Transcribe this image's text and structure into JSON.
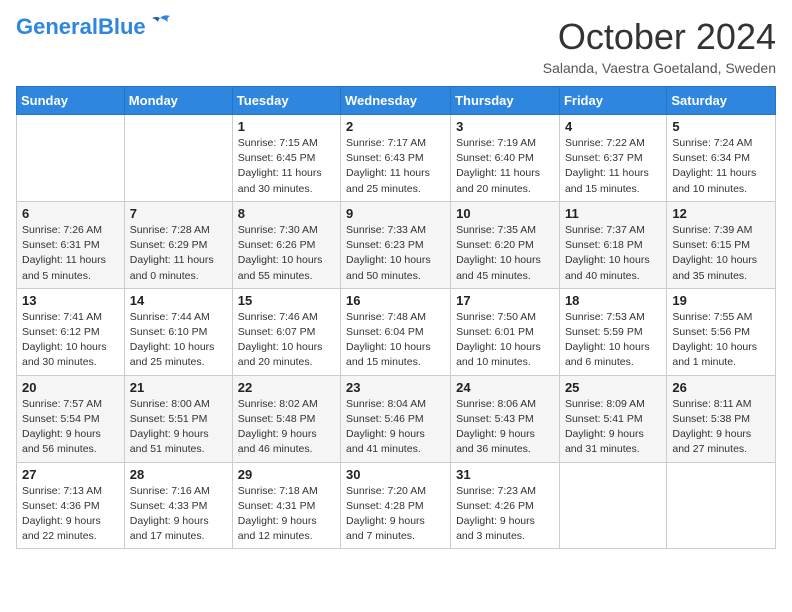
{
  "header": {
    "logo_general": "General",
    "logo_blue": "Blue",
    "month": "October 2024",
    "location": "Salanda, Vaestra Goetaland, Sweden"
  },
  "weekdays": [
    "Sunday",
    "Monday",
    "Tuesday",
    "Wednesday",
    "Thursday",
    "Friday",
    "Saturday"
  ],
  "weeks": [
    [
      {
        "day": "",
        "info": ""
      },
      {
        "day": "",
        "info": ""
      },
      {
        "day": "1",
        "info": "Sunrise: 7:15 AM\nSunset: 6:45 PM\nDaylight: 11 hours and 30 minutes."
      },
      {
        "day": "2",
        "info": "Sunrise: 7:17 AM\nSunset: 6:43 PM\nDaylight: 11 hours and 25 minutes."
      },
      {
        "day": "3",
        "info": "Sunrise: 7:19 AM\nSunset: 6:40 PM\nDaylight: 11 hours and 20 minutes."
      },
      {
        "day": "4",
        "info": "Sunrise: 7:22 AM\nSunset: 6:37 PM\nDaylight: 11 hours and 15 minutes."
      },
      {
        "day": "5",
        "info": "Sunrise: 7:24 AM\nSunset: 6:34 PM\nDaylight: 11 hours and 10 minutes."
      }
    ],
    [
      {
        "day": "6",
        "info": "Sunrise: 7:26 AM\nSunset: 6:31 PM\nDaylight: 11 hours and 5 minutes."
      },
      {
        "day": "7",
        "info": "Sunrise: 7:28 AM\nSunset: 6:29 PM\nDaylight: 11 hours and 0 minutes."
      },
      {
        "day": "8",
        "info": "Sunrise: 7:30 AM\nSunset: 6:26 PM\nDaylight: 10 hours and 55 minutes."
      },
      {
        "day": "9",
        "info": "Sunrise: 7:33 AM\nSunset: 6:23 PM\nDaylight: 10 hours and 50 minutes."
      },
      {
        "day": "10",
        "info": "Sunrise: 7:35 AM\nSunset: 6:20 PM\nDaylight: 10 hours and 45 minutes."
      },
      {
        "day": "11",
        "info": "Sunrise: 7:37 AM\nSunset: 6:18 PM\nDaylight: 10 hours and 40 minutes."
      },
      {
        "day": "12",
        "info": "Sunrise: 7:39 AM\nSunset: 6:15 PM\nDaylight: 10 hours and 35 minutes."
      }
    ],
    [
      {
        "day": "13",
        "info": "Sunrise: 7:41 AM\nSunset: 6:12 PM\nDaylight: 10 hours and 30 minutes."
      },
      {
        "day": "14",
        "info": "Sunrise: 7:44 AM\nSunset: 6:10 PM\nDaylight: 10 hours and 25 minutes."
      },
      {
        "day": "15",
        "info": "Sunrise: 7:46 AM\nSunset: 6:07 PM\nDaylight: 10 hours and 20 minutes."
      },
      {
        "day": "16",
        "info": "Sunrise: 7:48 AM\nSunset: 6:04 PM\nDaylight: 10 hours and 15 minutes."
      },
      {
        "day": "17",
        "info": "Sunrise: 7:50 AM\nSunset: 6:01 PM\nDaylight: 10 hours and 10 minutes."
      },
      {
        "day": "18",
        "info": "Sunrise: 7:53 AM\nSunset: 5:59 PM\nDaylight: 10 hours and 6 minutes."
      },
      {
        "day": "19",
        "info": "Sunrise: 7:55 AM\nSunset: 5:56 PM\nDaylight: 10 hours and 1 minute."
      }
    ],
    [
      {
        "day": "20",
        "info": "Sunrise: 7:57 AM\nSunset: 5:54 PM\nDaylight: 9 hours and 56 minutes."
      },
      {
        "day": "21",
        "info": "Sunrise: 8:00 AM\nSunset: 5:51 PM\nDaylight: 9 hours and 51 minutes."
      },
      {
        "day": "22",
        "info": "Sunrise: 8:02 AM\nSunset: 5:48 PM\nDaylight: 9 hours and 46 minutes."
      },
      {
        "day": "23",
        "info": "Sunrise: 8:04 AM\nSunset: 5:46 PM\nDaylight: 9 hours and 41 minutes."
      },
      {
        "day": "24",
        "info": "Sunrise: 8:06 AM\nSunset: 5:43 PM\nDaylight: 9 hours and 36 minutes."
      },
      {
        "day": "25",
        "info": "Sunrise: 8:09 AM\nSunset: 5:41 PM\nDaylight: 9 hours and 31 minutes."
      },
      {
        "day": "26",
        "info": "Sunrise: 8:11 AM\nSunset: 5:38 PM\nDaylight: 9 hours and 27 minutes."
      }
    ],
    [
      {
        "day": "27",
        "info": "Sunrise: 7:13 AM\nSunset: 4:36 PM\nDaylight: 9 hours and 22 minutes."
      },
      {
        "day": "28",
        "info": "Sunrise: 7:16 AM\nSunset: 4:33 PM\nDaylight: 9 hours and 17 minutes."
      },
      {
        "day": "29",
        "info": "Sunrise: 7:18 AM\nSunset: 4:31 PM\nDaylight: 9 hours and 12 minutes."
      },
      {
        "day": "30",
        "info": "Sunrise: 7:20 AM\nSunset: 4:28 PM\nDaylight: 9 hours and 7 minutes."
      },
      {
        "day": "31",
        "info": "Sunrise: 7:23 AM\nSunset: 4:26 PM\nDaylight: 9 hours and 3 minutes."
      },
      {
        "day": "",
        "info": ""
      },
      {
        "day": "",
        "info": ""
      }
    ]
  ]
}
